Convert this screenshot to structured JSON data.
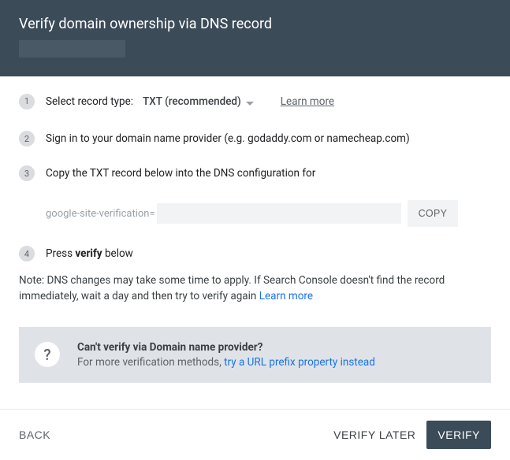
{
  "header": {
    "title": "Verify domain ownership via DNS record"
  },
  "steps": {
    "s1": {
      "num": "1",
      "label": "Select record type:",
      "dropdown": "TXT (recommended)",
      "learn_more": "Learn more"
    },
    "s2": {
      "num": "2",
      "text": "Sign in to your domain name provider (e.g. godaddy.com or namecheap.com)"
    },
    "s3": {
      "num": "3",
      "text": "Copy the TXT record below into the DNS configuration for"
    },
    "s4": {
      "num": "4",
      "prefix": "Press ",
      "bold": "verify",
      "suffix": " below"
    }
  },
  "txt": {
    "prefix": "google-site-verification=",
    "value": "",
    "copy": "COPY"
  },
  "note": {
    "text": "Note: DNS changes may take some time to apply. If Search Console doesn't find the record immediately, wait a day and then try to verify again ",
    "link": "Learn more"
  },
  "info": {
    "icon": "?",
    "title": "Can't verify via Domain name provider?",
    "text": "For more verification methods, ",
    "link": "try a URL prefix property instead"
  },
  "footer": {
    "back": "BACK",
    "verify_later": "VERIFY LATER",
    "verify": "VERIFY"
  }
}
